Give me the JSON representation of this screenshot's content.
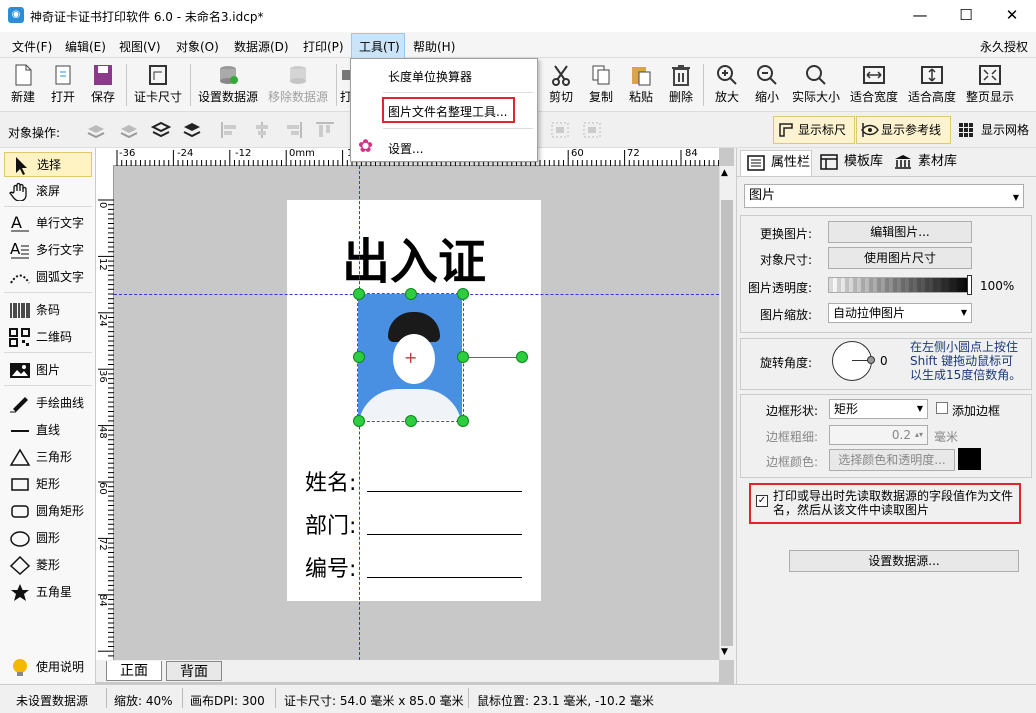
{
  "window": {
    "title": "神奇证卡证书打印软件 6.0 - 未命名3.idcp*",
    "minimize": "—",
    "maximize": "☐",
    "close": "✕"
  },
  "menubar": {
    "items": [
      "文件(F)",
      "编辑(E)",
      "视图(V)",
      "对象(O)",
      "数据源(D)",
      "打印(P)",
      "工具(T)",
      "帮助(H)"
    ],
    "license": "永久授权"
  },
  "tools_menu": {
    "items": [
      "长度单位换算器",
      "图片文件名整理工具...",
      "设置..."
    ]
  },
  "toolbar": {
    "items": [
      "新建",
      "打开",
      "保存",
      "证卡尺寸",
      "设置数据源",
      "移除数据源",
      "打",
      "剪切",
      "复制",
      "粘贴",
      "删除",
      "放大",
      "缩小",
      "实际大小",
      "适合宽度",
      "适合高度",
      "整页显示"
    ]
  },
  "object_ops": {
    "label": "对象操作:",
    "show_ruler": "显示标尺",
    "show_guides": "显示参考线",
    "show_grid": "显示网格"
  },
  "left_tools": [
    "选择",
    "滚屏",
    "单行文字",
    "多行文字",
    "圆弧文字",
    "条码",
    "二维码",
    "图片",
    "手绘曲线",
    "直线",
    "三角形",
    "矩形",
    "圆角矩形",
    "圆形",
    "菱形",
    "五角星",
    "使用说明"
  ],
  "ruler": {
    "top": [
      "-36",
      "-24",
      "-12",
      "0mm",
      "12",
      "24",
      "36",
      "48",
      "60",
      "72",
      "84"
    ],
    "left": [
      "0",
      "12",
      "24",
      "36",
      "48",
      "60",
      "72",
      "84"
    ]
  },
  "card": {
    "title": "出入证",
    "fields": [
      "姓名:",
      "部门:",
      "编号:"
    ]
  },
  "tabs": {
    "front": "正面",
    "back": "背面"
  },
  "right_panel": {
    "tabs": [
      "属性栏",
      "模板库",
      "素材库"
    ],
    "object_type": "图片",
    "replace_label": "更换图片:",
    "replace_btn": "编辑图片...",
    "size_label": "对象尺寸:",
    "size_btn": "使用图片尺寸",
    "opacity_label": "图片透明度:",
    "opacity_value": "100%",
    "scale_label": "图片缩放:",
    "scale_value": "自动拉伸图片",
    "rotate_label": "旋转角度:",
    "rotate_value": "0",
    "rotate_hint": "在左侧小圆点上按住 Shift 键拖动鼠标可以生成15度倍数角。",
    "border_shape_label": "边框形状:",
    "border_shape_value": "矩形",
    "add_border": "添加边框",
    "border_width_label": "边框粗细:",
    "border_width_value": "0.2",
    "border_width_unit": "毫米",
    "border_color_label": "边框颜色:",
    "border_color_btn": "选择颜色和透明度...",
    "datasource_check": "打印或导出时先读取数据源的字段值作为文件名，然后从该文件中读取图片",
    "datasource_btn": "设置数据源..."
  },
  "statusbar": {
    "datasource": "未设置数据源",
    "zoom": "缩放: 40%",
    "dpi": "画布DPI: 300",
    "card_size": "证卡尺寸: 54.0 毫米 x 85.0 毫米",
    "mouse": "鼠标位置: 23.1 毫米, -10.2 毫米"
  },
  "colors": {
    "accent": "#2a8fd8",
    "handle": "#2ecc40",
    "guide": "#2b3fd6",
    "highlight": "#e0262b"
  }
}
